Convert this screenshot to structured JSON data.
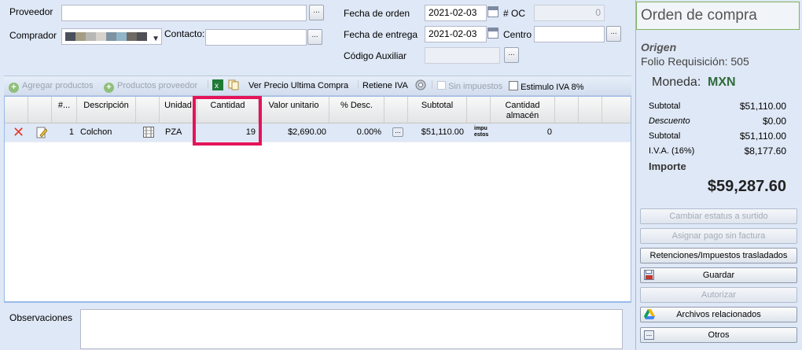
{
  "form": {
    "proveedor_label": "Proveedor",
    "proveedor_value": "",
    "comprador_label": "Comprador",
    "contacto_label": "Contacto:",
    "contacto_value": "",
    "fecha_orden_label": "Fecha de orden",
    "fecha_orden_value": "2021-02-03",
    "oc_label": "# OC",
    "oc_value": "0",
    "fecha_entrega_label": "Fecha de entrega",
    "fecha_entrega_value": "2021-02-03",
    "centro_label": "Centro",
    "centro_value": "",
    "codigo_aux_label": "Código Auxiliar",
    "codigo_aux_value": "",
    "dots": "..."
  },
  "toolbar": {
    "agregar_productos": "Agregar productos",
    "productos_proveedor": "Productos proveedor",
    "ver_precio": "Ver Precio Ultima Compra",
    "retiene_iva": "Retiene IVA",
    "sin_impuestos": "Sin impuestos",
    "estimulo_iva": "Estimulo IVA 8%"
  },
  "grid": {
    "headers": {
      "num": "#...",
      "descripcion": "Descripción",
      "unidad": "Unidad",
      "cantidad": "Cantidad",
      "valor_unitario": "Valor unitario",
      "desc": "% Desc.",
      "subtotal": "Subtotal",
      "cantidad_almacen": "Cantidad almacén"
    },
    "rows": [
      {
        "num": "1",
        "descripcion": "Colchon",
        "unidad": "PZA",
        "cantidad": "19",
        "valor_unitario": "$2,690.00",
        "desc": "0.00%",
        "subtotal": "$51,110.00",
        "impuestos": "impu estos",
        "cantidad_almacen": "0"
      }
    ]
  },
  "observaciones": {
    "label": "Observaciones",
    "value": ""
  },
  "side": {
    "title": "Orden de compra",
    "origen": "Origen",
    "folio": "Folio Requisición: 505",
    "moneda_label": "Moneda:",
    "moneda_value": "MXN",
    "summary": [
      {
        "label": "Subtotal",
        "value": "$51,110.00",
        "italic": false
      },
      {
        "label": "Descuento",
        "value": "$0.00",
        "italic": true
      },
      {
        "label": "Subtotal",
        "value": "$51,110.00",
        "italic": false
      },
      {
        "label": "I.V.A. (16%)",
        "value": "$8,177.60",
        "italic": false
      }
    ],
    "importe_label": "Importe",
    "importe_value": "$59,287.60",
    "buttons": {
      "cambiar_estatus": "Cambiar estatus a surtido",
      "asignar_pago": "Asignar pago sin factura",
      "retenciones": "Retenciones/Impuestos trasladados",
      "guardar": "Guardar",
      "autorizar": "Autorizar",
      "archivos": "Archivos relacionados",
      "otros": "Otros"
    }
  },
  "colors": {
    "accent_green": "#2f6b3a",
    "highlight": "#e4145a",
    "delete_red": "#e53a2a"
  }
}
